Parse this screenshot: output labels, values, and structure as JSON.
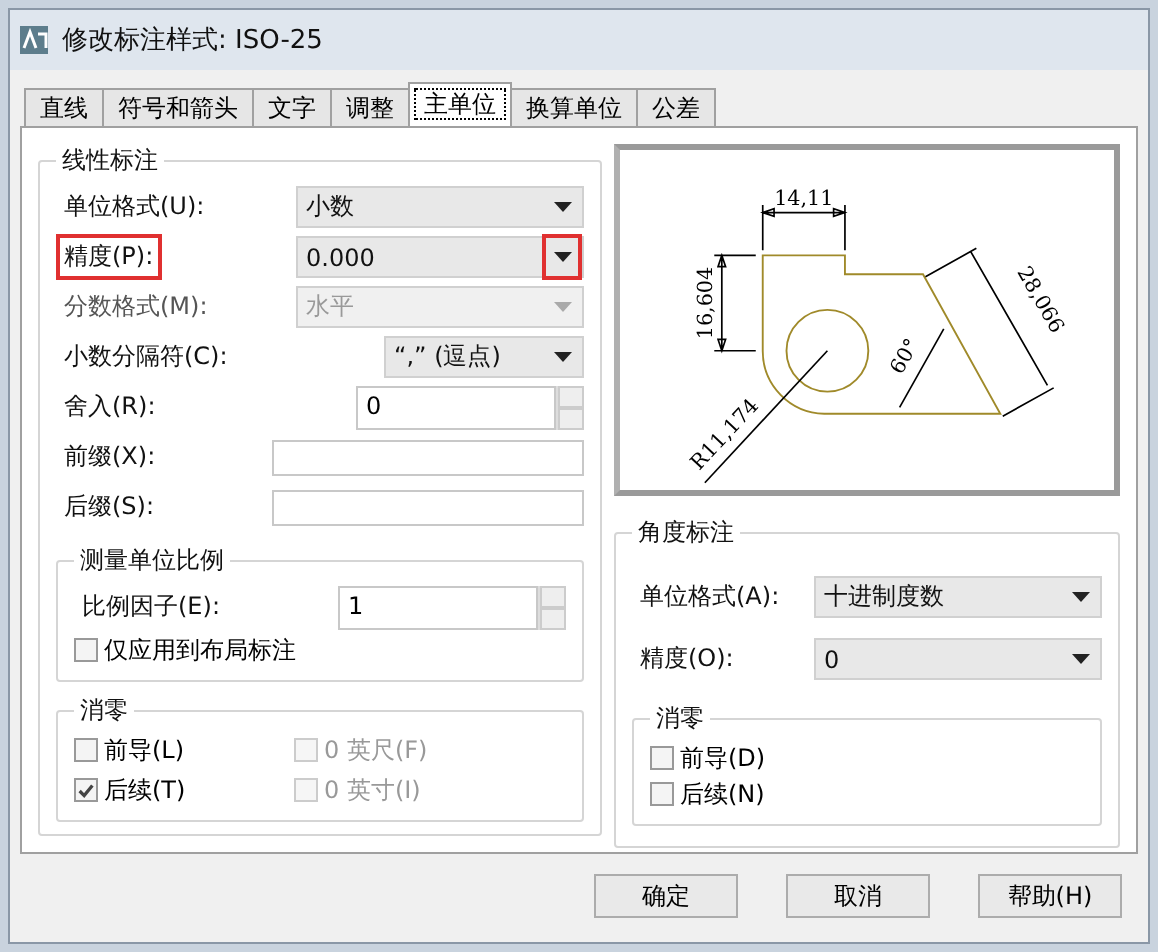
{
  "window": {
    "title": "修改标注样式: ISO-25"
  },
  "tabs": [
    {
      "label": "直线",
      "selected": false
    },
    {
      "label": "符号和箭头",
      "selected": false
    },
    {
      "label": "文字",
      "selected": false
    },
    {
      "label": "调整",
      "selected": false
    },
    {
      "label": "主单位",
      "selected": true
    },
    {
      "label": "换算单位",
      "selected": false
    },
    {
      "label": "公差",
      "selected": false
    }
  ],
  "linear": {
    "title": "线性标注",
    "rows": [
      {
        "kind": "select",
        "label": "单位格式(U):",
        "value": "小数",
        "disabled": false,
        "highlighted": false
      },
      {
        "kind": "select",
        "label": "精度(P):",
        "value": "0.000",
        "disabled": false,
        "highlighted": true
      },
      {
        "kind": "select",
        "label": "分数格式(M):",
        "value": "水平",
        "disabled": true,
        "highlighted": false
      },
      {
        "kind": "select-short",
        "label": "小数分隔符(C):",
        "value": "“,” (逗点)",
        "disabled": false,
        "highlighted": false
      },
      {
        "kind": "spin",
        "label": "舍入(R):",
        "value": "0",
        "disabled": false,
        "highlighted": false
      },
      {
        "kind": "text",
        "label": "前缀(X):",
        "disabled": false,
        "highlighted": false
      },
      {
        "kind": "text",
        "label": "后缀(S):",
        "disabled": false,
        "highlighted": false
      }
    ],
    "scale": {
      "title": "测量单位比例",
      "factor_label": "比例因子(E):",
      "factor": "1",
      "layout_only": {
        "label": "仅应用到布局标注",
        "checked": false,
        "disabled": false
      }
    },
    "zero": {
      "title": "消零",
      "items": [
        {
          "label": "前导(L)",
          "checked": false,
          "disabled": false
        },
        {
          "label": "0 英尺(F)",
          "checked": false,
          "disabled": true
        },
        {
          "label": "后续(T)",
          "checked": true,
          "disabled": false
        },
        {
          "label": "0 英寸(I)",
          "checked": false,
          "disabled": true
        }
      ]
    }
  },
  "preview": {
    "labels": [
      "14,11",
      "16,604",
      "28,066",
      "60°",
      "R11,174"
    ]
  },
  "angular": {
    "title": "角度标注",
    "rows": [
      {
        "kind": "select",
        "label": "单位格式(A):",
        "value": "十进制度数",
        "disabled": false,
        "highlighted": false
      },
      {
        "kind": "select",
        "label": "精度(O):",
        "value": "0",
        "disabled": false,
        "highlighted": false
      }
    ],
    "zero": {
      "title": "消零",
      "items": [
        {
          "label": "前导(D)",
          "checked": false,
          "disabled": false
        },
        {
          "label": "后续(N)",
          "checked": false,
          "disabled": false
        }
      ]
    }
  },
  "buttons": [
    "确定",
    "取消",
    "帮助(H)"
  ]
}
